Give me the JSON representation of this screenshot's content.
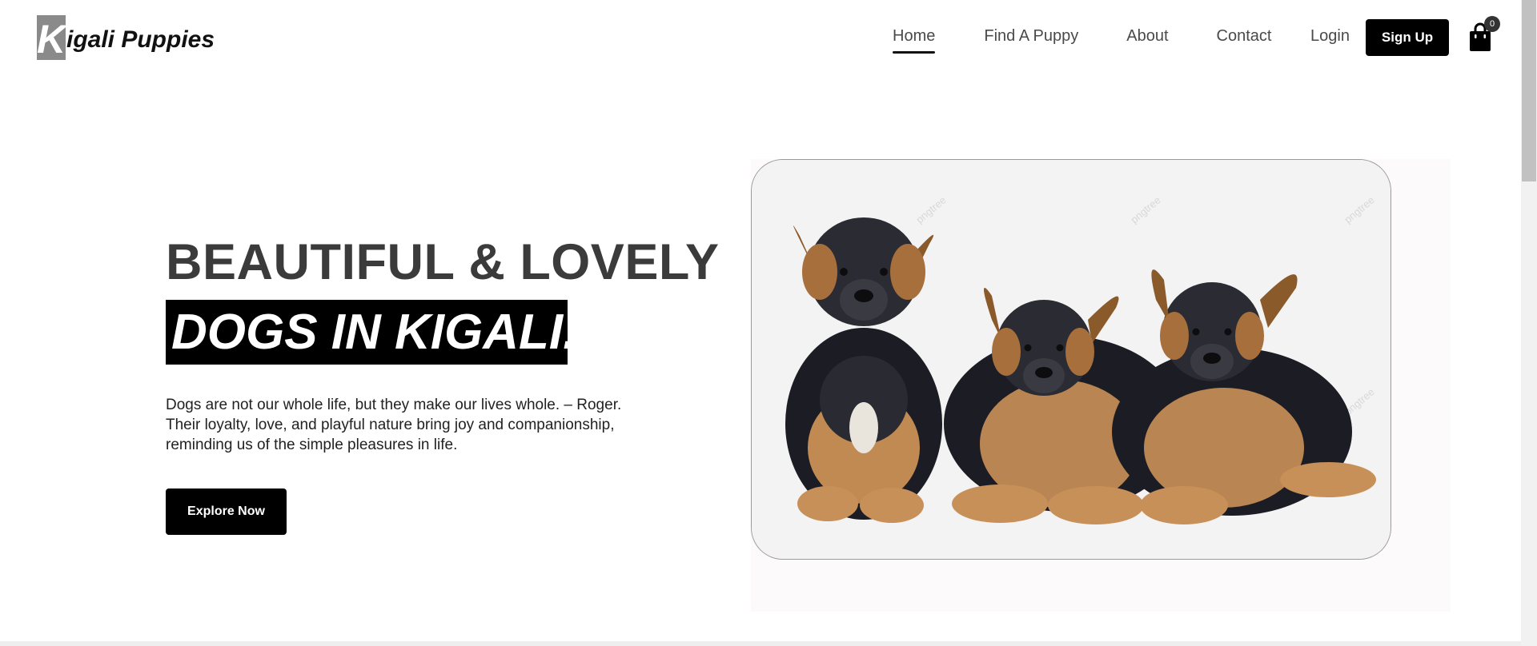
{
  "brand": {
    "logo_letter": "K",
    "logo_rest": "igali Puppies"
  },
  "nav": {
    "items": [
      {
        "label": "Home",
        "active": true
      },
      {
        "label": "Find A Puppy",
        "active": false
      },
      {
        "label": "About",
        "active": false
      },
      {
        "label": "Contact",
        "active": false
      }
    ],
    "login_label": "Login",
    "signup_label": "Sign Up",
    "cart_count": "0"
  },
  "hero": {
    "title_line1": "BEAUTIFUL & LOVELY",
    "title_line2": "DOGS IN KIGALI.",
    "description": "Dogs are not our whole life, but they make our lives whole. – Roger. Their loyalty, love, and playful nature bring joy and companionship, reminding us of the simple pleasures in life.",
    "cta_label": "Explore Now",
    "image_watermark": "pngtree"
  },
  "colors": {
    "primary": "#000000",
    "text": "#3b3b3b",
    "nav_text": "#4a4a4a",
    "logo_box": "#8a8a8a",
    "card_bg": "#f3f3f3"
  },
  "icons": {
    "cart": "shopping-bag-icon"
  }
}
